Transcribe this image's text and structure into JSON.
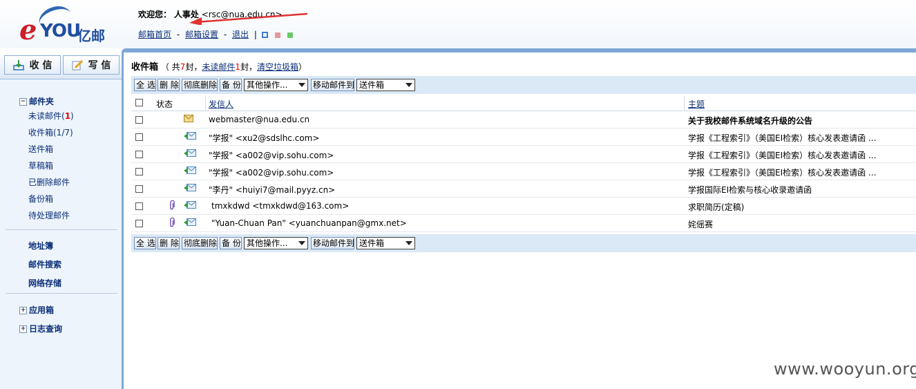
{
  "header": {
    "logo": {
      "e": "e",
      "you": "YOU",
      "yi": "亿邮"
    },
    "welcome_label": "欢迎您：",
    "user_name": "人事处",
    "user_email": "<rsc@nua.edu.cn>",
    "links": [
      "邮箱首页",
      "邮箱设置",
      "退出"
    ],
    "link_sep": "-",
    "pipe": "|",
    "skin_colors": [
      "#3d7bd1",
      "#e49a9a",
      "#6cc76c"
    ],
    "arrow_color": "#e03030"
  },
  "sidebar": {
    "receive_label": "收 信",
    "compose_label": "写 信",
    "folder_head": "邮件夹",
    "folders": [
      {
        "label": "未读邮件(",
        "count": "1",
        "suffix": ")"
      },
      {
        "label": "收件箱(1/7)"
      },
      {
        "label": "送件箱"
      },
      {
        "label": "草稿箱"
      },
      {
        "label": "已删除邮件"
      },
      {
        "label": "备份箱"
      },
      {
        "label": "待处理邮件"
      }
    ],
    "tools": [
      "地址簿",
      "邮件搜索",
      "网络存储"
    ],
    "apps": [
      "应用箱",
      "日志查询"
    ],
    "toggle_minus": "−",
    "toggle_plus": "+"
  },
  "main": {
    "title": "收件箱",
    "summary_open": "（ 共",
    "total": "7",
    "summary_mid": "封，",
    "unread_link": "未读邮件",
    "unread": "1",
    "summary_mid2": "封，",
    "empty_trash": "清空垃圾箱",
    "summary_close": "）",
    "toolbar": {
      "select_all": "全 选",
      "delete": "删 除",
      "perm_delete": "彻底删除",
      "backup": "备 份",
      "other_ops": "其他操作...",
      "move_to": "移动邮件到",
      "move_target": "送件箱"
    },
    "columns": {
      "status": "状态",
      "sender": "发信人",
      "subject": "主题"
    },
    "rows": [
      {
        "sender": "webmaster@nua.edu.cn",
        "subject": "关于我校邮件系统域名升级的公告",
        "bold": true,
        "attach": false,
        "icon": "unread-envelope-icon"
      },
      {
        "sender": "\"学报\" <xu2@sdslhc.com>",
        "subject": "学报《工程索引》（美国EI检索）核心发表邀请函 ...",
        "bold": false,
        "attach": false,
        "icon": "replied-envelope-icon"
      },
      {
        "sender": "\"学报\" <a002@vip.sohu.com>",
        "subject": "学报《工程索引》（美国EI检索）核心发表邀请函 ...",
        "bold": false,
        "attach": false,
        "icon": "replied-envelope-icon"
      },
      {
        "sender": "\"学报\" <a002@vip.sohu.com>",
        "subject": "学报《工程索引》（美国EI检索）核心发表邀请函 ...",
        "bold": false,
        "attach": false,
        "icon": "replied-envelope-icon"
      },
      {
        "sender": "\"李丹\" <huiyi7@mail.pyyz.cn>",
        "subject": "学报国际EI检索与核心收录邀请函",
        "bold": false,
        "attach": false,
        "icon": "replied-envelope-icon"
      },
      {
        "sender": "tmxkdwd <tmxkdwd@163.com>",
        "subject": "求职简历(定稿)",
        "bold": false,
        "attach": true,
        "icon": "replied-envelope-icon"
      },
      {
        "sender": "\"Yuan-Chuan Pan\" <yuanchuanpan@gmx.net>",
        "subject": "姹傜赛",
        "bold": false,
        "attach": true,
        "icon": "replied-envelope-icon"
      }
    ]
  },
  "watermark": "www.wooyun.org"
}
